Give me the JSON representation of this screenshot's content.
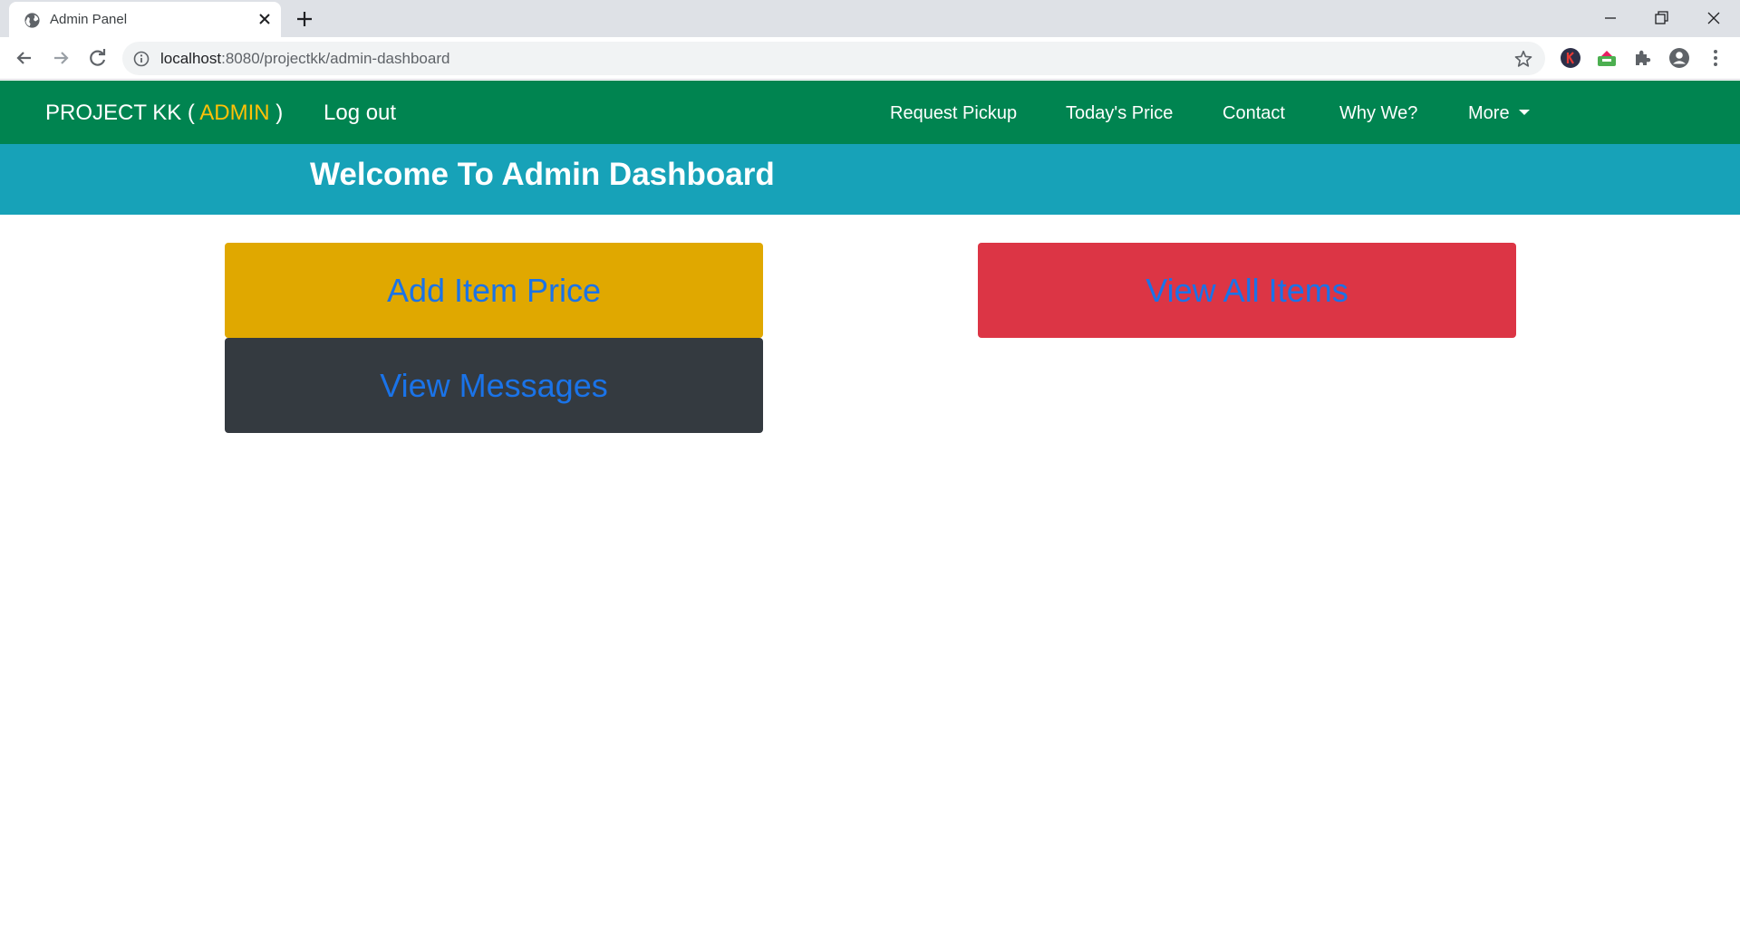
{
  "browser": {
    "tab_title": "Admin Panel",
    "url_host": "localhost",
    "url_path": ":8080/projectkk/admin-dashboard",
    "icons": [
      "globe-icon",
      "close-icon",
      "plus-icon",
      "minimize-icon",
      "restore-icon",
      "close-window-icon",
      "back-arrow-icon",
      "forward-arrow-icon",
      "reload-icon",
      "info-icon",
      "star-icon",
      "k-extension-icon",
      "inbox-extension-icon",
      "puzzle-icon",
      "profile-icon",
      "kebab-menu-icon"
    ]
  },
  "navbar": {
    "brand_prefix": "PROJECT KK (",
    "brand_highlight": "ADMIN",
    "brand_suffix": " )",
    "logout": "Log out",
    "links": [
      "Request Pickup",
      "Today's Price",
      "Contact",
      "Why We?"
    ],
    "more": "More",
    "colors": {
      "background": "#008450",
      "highlight": "#ffc107"
    }
  },
  "welcome": {
    "title": "Welcome To Admin Dashboard",
    "color": "#17a2b8"
  },
  "cards": {
    "add_item_price": {
      "label": "Add Item Price",
      "color": "#e0a800"
    },
    "view_all_items": {
      "label": "View All Items",
      "color": "#dc3545"
    },
    "view_messages": {
      "label": "View Messages",
      "color": "#343a40"
    },
    "text_color": "#1a73e8"
  }
}
